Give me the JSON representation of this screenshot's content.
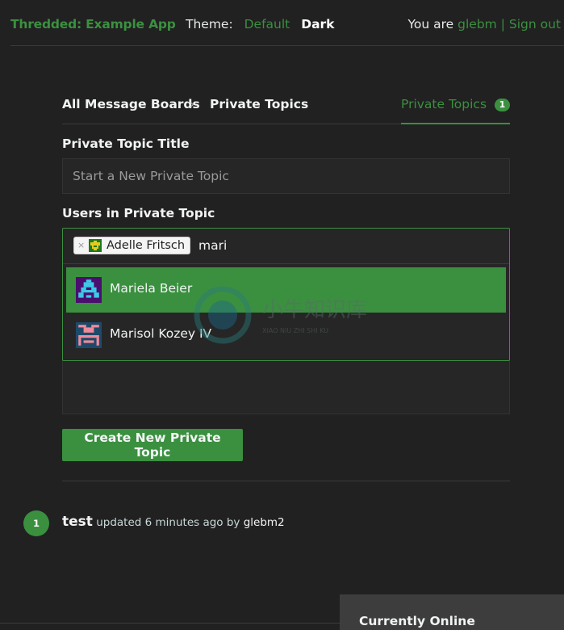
{
  "header": {
    "app_title": "Thredded: Example App",
    "theme_label": "Theme:",
    "theme_options": [
      {
        "label": "Default",
        "selected": false
      },
      {
        "label": "Dark",
        "selected": true
      }
    ],
    "you_are": "You are",
    "username": "glebm",
    "separator": "|",
    "sign_out": "Sign out"
  },
  "nav": {
    "breadcrumb": [
      "All Message Boards",
      "Private Topics"
    ],
    "breadcrumb_separator": "›",
    "private_topics_tab": {
      "label": "Private Topics",
      "count": "1"
    }
  },
  "form": {
    "title_label": "Private Topic Title",
    "title_placeholder": "Start a New Private Topic",
    "title_value": "",
    "users_label": "Users in Private Topic",
    "selected_users": [
      {
        "name": "Adelle Fritsch",
        "remove_icon": "×",
        "avatar_colors": {
          "bg": "#1c7a1c",
          "fg": "#e8c81c"
        }
      }
    ],
    "users_query": "mari",
    "suggestions": [
      {
        "name": "Mariela Beier",
        "active": true,
        "avatar_colors": {
          "bg": "#4a0e6e",
          "fg": "#3ec8e8"
        }
      },
      {
        "name": "Marisol Kozey IV",
        "active": false,
        "avatar_colors": {
          "bg": "#1e4a6a",
          "fg": "#f08a9a"
        }
      }
    ],
    "submit_label": "Create New Private Topic"
  },
  "topics": [
    {
      "count": "1",
      "title": "test",
      "updated_text": "updated 6 minutes ago by",
      "user": "glebm2"
    }
  ],
  "sidebar": {
    "currently_online_title": "Currently Online"
  },
  "colors": {
    "accent": "#3b9040",
    "background": "#212121",
    "input_bg": "#262626"
  },
  "watermark": {
    "text": "小牛知识库",
    "subtext": "XIAO NIU ZHI SHI KU"
  }
}
